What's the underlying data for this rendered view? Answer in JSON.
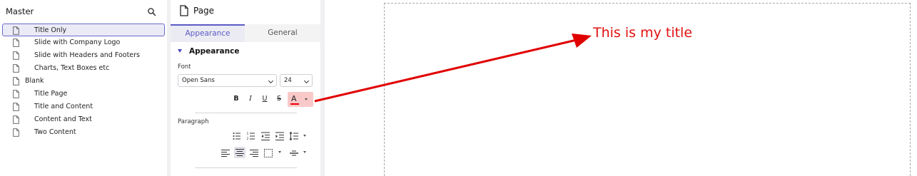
{
  "master": {
    "title": "Master",
    "items": [
      {
        "label": "Title Only",
        "indent": 1,
        "selected": true
      },
      {
        "label": "Slide with Company Logo",
        "indent": 1,
        "selected": false
      },
      {
        "label": "Slide with Headers and Footers",
        "indent": 1,
        "selected": false
      },
      {
        "label": "Charts, Text Boxes etc",
        "indent": 1,
        "selected": false
      },
      {
        "label": "Blank",
        "indent": 0,
        "selected": false
      },
      {
        "label": "Title Page",
        "indent": 1,
        "selected": false
      },
      {
        "label": "Title and Content",
        "indent": 1,
        "selected": false
      },
      {
        "label": "Content and Text",
        "indent": 1,
        "selected": false
      },
      {
        "label": "Two Content",
        "indent": 1,
        "selected": false
      }
    ]
  },
  "props": {
    "title": "Page",
    "tabs": {
      "appearance": "Appearance",
      "general": "General"
    },
    "section": "Appearance",
    "font_label": "Font",
    "font_value": "Open Sans",
    "size_value": "24",
    "bold": "B",
    "italic": "I",
    "underline": "U",
    "strike": "S",
    "color_a": "A",
    "paragraph_label": "Paragraph"
  },
  "slide": {
    "title_text": "This is my title",
    "title_color": "#e11111"
  },
  "colors": {
    "accent": "#5b5bc6",
    "annotation_arrow": "#e00000",
    "color_button_bg": "#f9c9c9"
  }
}
